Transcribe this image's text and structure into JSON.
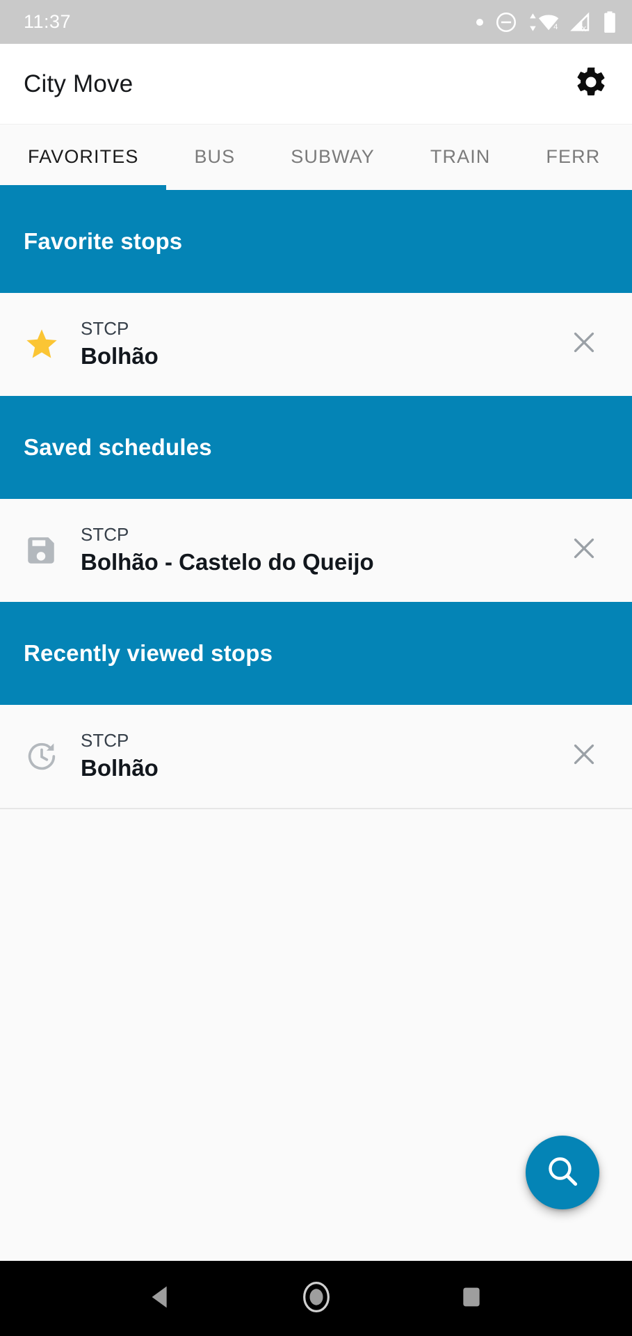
{
  "statusbar": {
    "clock": "11:37",
    "icons": [
      {
        "name": "dot-indicator-icon"
      },
      {
        "name": "do-not-disturb-icon"
      },
      {
        "name": "wifi-transfer-icon",
        "badge": "4"
      },
      {
        "name": "mobile-signal-off-icon"
      },
      {
        "name": "battery-icon"
      }
    ]
  },
  "appbar": {
    "title": "City Move",
    "settings_icon": "gear-icon"
  },
  "tabs": [
    {
      "label": "FAVORITES",
      "active": true
    },
    {
      "label": "BUS",
      "active": false
    },
    {
      "label": "SUBWAY",
      "active": false
    },
    {
      "label": "TRAIN",
      "active": false
    },
    {
      "label": "FERR",
      "active": false
    }
  ],
  "sections": [
    {
      "title": "Favorite stops",
      "rows": [
        {
          "icon": "star-icon",
          "operator": "STCP",
          "name": "Bolhão",
          "close_icon": "close-icon"
        }
      ]
    },
    {
      "title": "Saved schedules",
      "rows": [
        {
          "icon": "save-floppy-icon",
          "operator": "STCP",
          "name": "Bolhão - Castelo do Queijo",
          "close_icon": "close-icon"
        }
      ]
    },
    {
      "title": "Recently viewed stops",
      "rows": [
        {
          "icon": "history-icon",
          "operator": "STCP",
          "name": "Bolhão",
          "close_icon": "close-icon"
        }
      ]
    }
  ],
  "fab": {
    "icon": "search-icon",
    "label": "Search"
  },
  "navbar": {
    "back": "back-triangle-icon",
    "home": "home-circle-icon",
    "recents": "recents-square-icon"
  },
  "colors": {
    "accent": "#0484b6",
    "statusbar_bg": "#c9c9c9",
    "appbar_bg": "#ffffff",
    "page_bg": "#fafafa",
    "star": "#fbc534",
    "icon_gray": "#b3b8bd",
    "close_gray": "#9aa0a6",
    "navbar_bg": "#000000",
    "nav_icon": "#9e9e9e"
  }
}
